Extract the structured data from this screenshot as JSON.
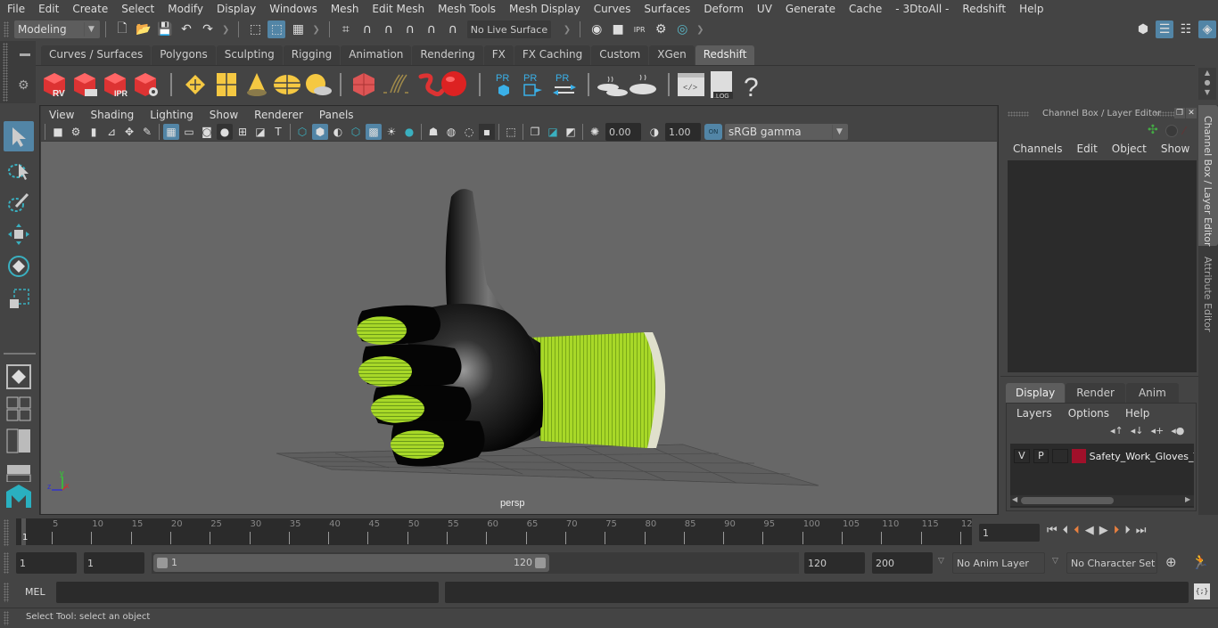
{
  "menubar": {
    "items": [
      "File",
      "Edit",
      "Create",
      "Select",
      "Modify",
      "Display",
      "Windows",
      "Mesh",
      "Edit Mesh",
      "Mesh Tools",
      "Mesh Display",
      "Curves",
      "Surfaces",
      "Deform",
      "UV",
      "Generate",
      "Cache",
      "- 3DtoAll -",
      "Redshift",
      "Help"
    ]
  },
  "statusline": {
    "workspace": "Modeling",
    "live_surface": "No Live Surface"
  },
  "shelf": {
    "tabs": [
      "Curves / Surfaces",
      "Polygons",
      "Sculpting",
      "Rigging",
      "Animation",
      "Rendering",
      "FX",
      "FX Caching",
      "Custom",
      "XGen",
      "Redshift"
    ],
    "active_tab": "Redshift",
    "icon_labels": {
      "rv": "RV",
      "ipr": "IPR",
      "pr": "PR",
      "log": ".LOG",
      "help": "?"
    }
  },
  "viewport": {
    "menu": [
      "View",
      "Shading",
      "Lighting",
      "Show",
      "Renderer",
      "Panels"
    ],
    "exposure": "0.00",
    "gamma": "1.00",
    "color_mgmt_on": "ON",
    "color_space": "sRGB gamma",
    "camera_label": "persp",
    "axis": {
      "x": "x",
      "y": "y",
      "z": "z"
    }
  },
  "channel_box": {
    "title": "Channel Box / Layer Editor",
    "menu": [
      "Channels",
      "Edit",
      "Object",
      "Show"
    ],
    "layer_tabs": [
      "Display",
      "Render",
      "Anim"
    ],
    "active_layer_tab": "Display",
    "layer_menu": [
      "Layers",
      "Options",
      "Help"
    ],
    "layers": [
      {
        "v": "V",
        "p": "P",
        "color": "#a0102a",
        "name": "Safety_Work_Gloves_T"
      }
    ]
  },
  "side_tabs": [
    "Channel Box / Layer Editor",
    "Attribute Editor"
  ],
  "timeline": {
    "ticks": [
      "5",
      "10",
      "15",
      "20",
      "25",
      "30",
      "35",
      "40",
      "45",
      "50",
      "55",
      "60",
      "65",
      "70",
      "75",
      "80",
      "85",
      "90",
      "95",
      "100",
      "105",
      "110",
      "115",
      "12"
    ],
    "current_frame_marker": "1",
    "current_frame": "1"
  },
  "range": {
    "start": "1",
    "anim_start": "1",
    "slider_start": "1",
    "slider_end": "120",
    "end": "120",
    "anim_end": "200",
    "anim_layer": "No Anim Layer",
    "character_set": "No Character Set"
  },
  "cmdline": {
    "label": "MEL"
  },
  "helpline": {
    "text": "Select Tool: select an object"
  }
}
